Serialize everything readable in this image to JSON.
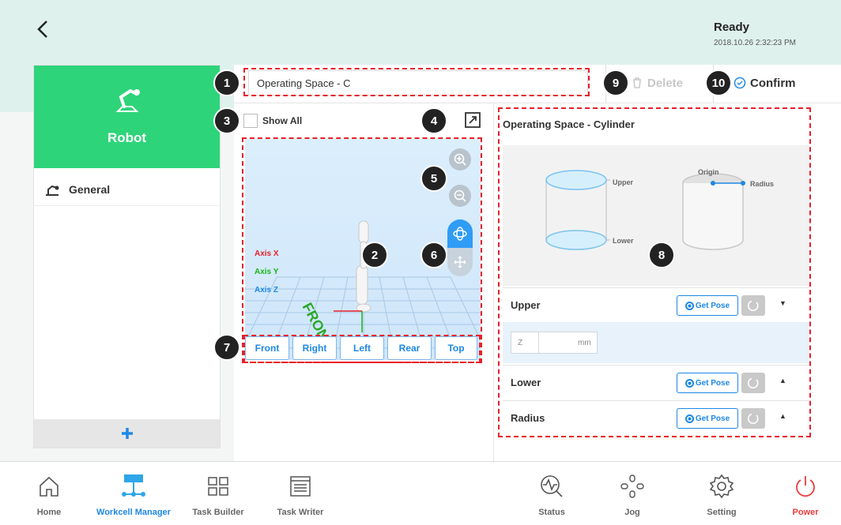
{
  "status": {
    "title": "Ready",
    "timestamp": "2018.10.26 2:32:23 PM"
  },
  "sidebar": {
    "robot_label": "Robot",
    "items": [
      {
        "label": "General"
      }
    ],
    "add_label": "+"
  },
  "space": {
    "name_value": "Operating Space - C",
    "delete_label": "Delete",
    "confirm_label": "Confirm",
    "show_all_label": "Show All"
  },
  "viewport": {
    "axis_labels": [
      {
        "label": "Axis X",
        "color": "#e8202a"
      },
      {
        "label": "Axis Y",
        "color": "#16b716"
      },
      {
        "label": "Axis Z",
        "color": "#1e88e5"
      }
    ],
    "front_text": "FRONT",
    "view_buttons": [
      "Front",
      "Right",
      "Left",
      "Rear",
      "Top"
    ]
  },
  "panel": {
    "title": "Operating Space - Cylinder",
    "diagram": {
      "upper": "Upper",
      "lower": "Lower",
      "origin": "Origin",
      "radius": "Radius"
    },
    "rows": [
      {
        "label": "Upper",
        "get_pose": "Get Pose",
        "caret": "▼"
      },
      {
        "label": "Lower",
        "get_pose": "Get Pose",
        "caret": "▲"
      },
      {
        "label": "Radius",
        "get_pose": "Get Pose",
        "caret": "▲"
      }
    ],
    "z_field": {
      "axis": "Z",
      "value": "",
      "unit": "mm"
    }
  },
  "badges": [
    "1",
    "2",
    "3",
    "4",
    "5",
    "6",
    "7",
    "8",
    "9",
    "10"
  ],
  "nav": {
    "home": "Home",
    "workcell_manager": "Workcell Manager",
    "task_builder": "Task Builder",
    "task_writer": "Task Writer",
    "status": "Status",
    "jog": "Jog",
    "setting": "Setting",
    "power": "Power"
  },
  "colors": {
    "accent_green": "#2ed47a",
    "brand_blue": "#1e88e5",
    "header_bg": "#dff1ed",
    "annotation_red": "#e8202a",
    "power_red": "#ee3b3b"
  }
}
